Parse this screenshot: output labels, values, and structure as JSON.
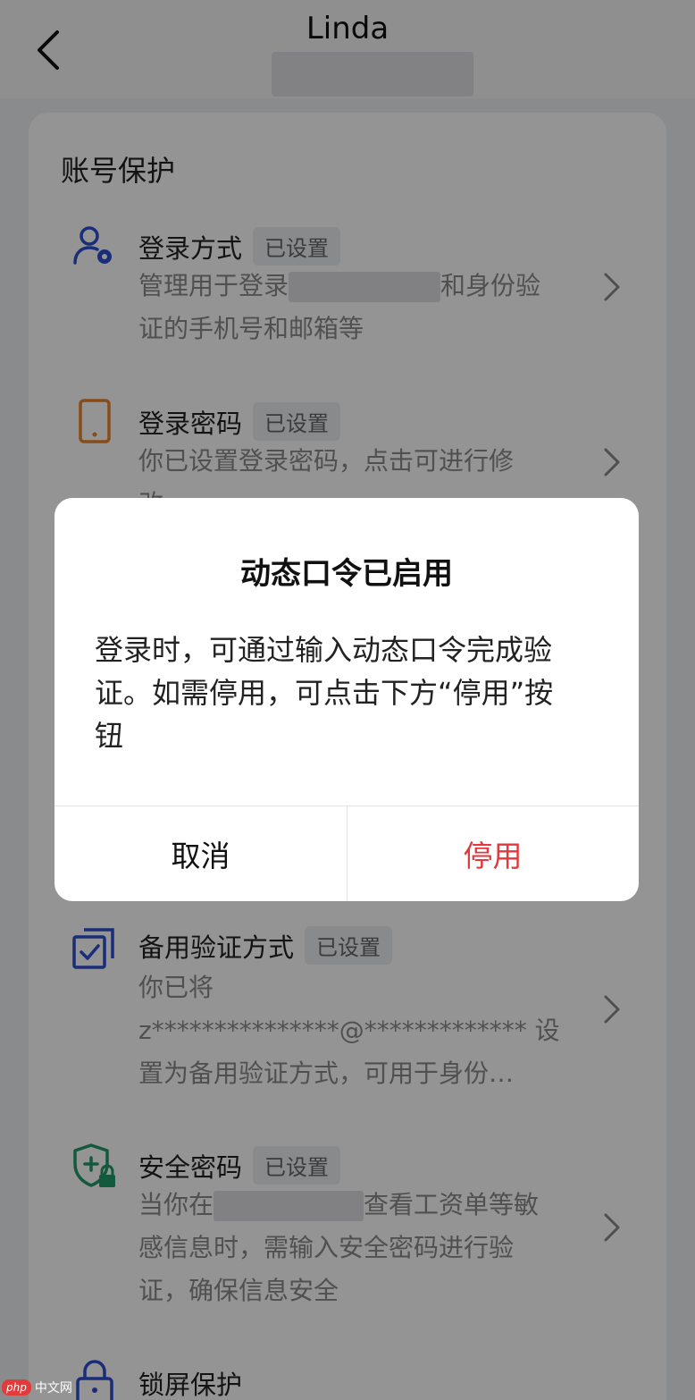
{
  "header": {
    "title": "Linda",
    "back_icon": "chevron-left-icon"
  },
  "section": {
    "title": "账号保护"
  },
  "items": [
    {
      "title": "登录方式",
      "badge": "已设置",
      "icon": "user-gear-icon",
      "desc_part1": "管理用于登录",
      "desc_part2": "和身份验",
      "desc_line2": "证的手机号和邮箱等"
    },
    {
      "title": "登录密码",
      "badge": "已设置",
      "icon": "phone-icon",
      "desc_line1": "你已设置登录密码，点击可进行修",
      "desc_line2": "改"
    },
    {
      "title": "备用验证方式",
      "badge": "已设置",
      "icon": "backup-check-icon",
      "desc_line1": "你已将",
      "desc_line2": "z***************@************* 设",
      "desc_line3": "置为备用验证方式，可用于身份…"
    },
    {
      "title": "安全密码",
      "badge": "已设置",
      "icon": "shield-lock-icon",
      "desc_part1": "当你在",
      "desc_part2": "查看工资单等敏",
      "desc_line2": "感信息时，需输入安全密码进行验",
      "desc_line3": "证，确保信息安全"
    },
    {
      "title": "锁屏保护",
      "icon": "lock-icon"
    }
  ],
  "dialog": {
    "title": "动态口令已启用",
    "body_line1": "登录时，可通过输入动态口令完成验",
    "body_line2": "证。如需停用，可点击下方“停用”按",
    "body_line3": "钮",
    "cancel_label": "取消",
    "disable_label": "停用"
  },
  "watermark": {
    "badge": "php",
    "text": "中文网"
  },
  "colors": {
    "accent_blue": "#2d4fd0",
    "accent_orange": "#e8842a",
    "accent_green": "#1f9a6c",
    "danger_red": "#e0393e"
  }
}
